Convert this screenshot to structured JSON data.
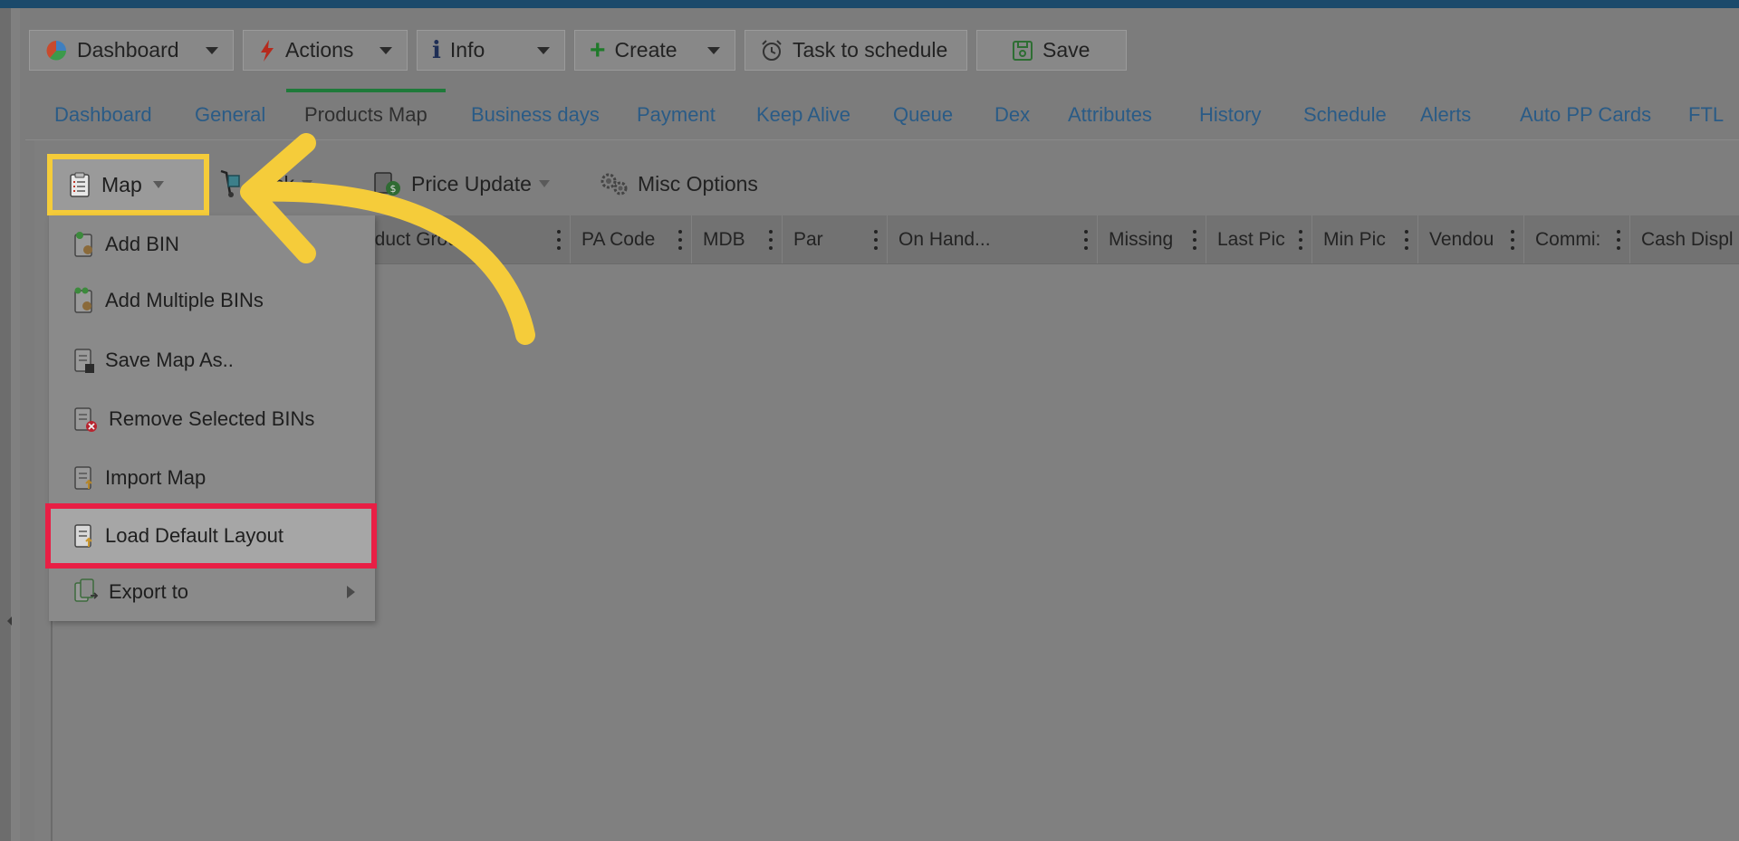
{
  "toolbar": {
    "dashboard_label": "Dashboard",
    "actions_label": "Actions",
    "info_label": "Info",
    "create_label": "Create",
    "task_label": "Task to schedule",
    "save_label": "Save"
  },
  "tabs": [
    {
      "label": "Dashboard"
    },
    {
      "label": "General"
    },
    {
      "label": "Products Map"
    },
    {
      "label": "Business days"
    },
    {
      "label": "Payment"
    },
    {
      "label": "Keep Alive"
    },
    {
      "label": "Queue"
    },
    {
      "label": "Dex"
    },
    {
      "label": "Attributes"
    },
    {
      "label": "History"
    },
    {
      "label": "Schedule"
    },
    {
      "label": "Alerts"
    },
    {
      "label": "Auto PP Cards"
    },
    {
      "label": "FTL"
    }
  ],
  "subtoolbar": {
    "map_label": "Map",
    "pick_label": "ck",
    "price_update_label": "Price Update",
    "misc_label": "Misc Options"
  },
  "grid": {
    "columns": [
      {
        "label": "oduct Group"
      },
      {
        "label": "PA Code"
      },
      {
        "label": "MDB"
      },
      {
        "label": "Par"
      },
      {
        "label": "On Hand..."
      },
      {
        "label": "Missing"
      },
      {
        "label": "Last Pic"
      },
      {
        "label": "Min Pic"
      },
      {
        "label": "Vendou"
      },
      {
        "label": "Commi:"
      },
      {
        "label": "Cash Displ"
      }
    ]
  },
  "menu": {
    "items": [
      {
        "label": "Add BIN",
        "icon": "add-bin-icon"
      },
      {
        "label": "Add Multiple BINs",
        "icon": "add-multiple-bins-icon"
      },
      {
        "label": "Save Map As..",
        "icon": "save-map-icon"
      },
      {
        "label": "Remove Selected BINs",
        "icon": "remove-bins-icon"
      },
      {
        "label": "Import Map",
        "icon": "import-map-icon"
      },
      {
        "label": "Load Default Layout",
        "icon": "load-layout-icon"
      },
      {
        "label": "Export to",
        "icon": "export-icon"
      }
    ]
  },
  "colors": {
    "highlight_yellow": "#f5cc3a",
    "highlight_red": "#e81f45",
    "tab_text": "#2a5b86",
    "active_tab_border": "#1f7a3a"
  }
}
